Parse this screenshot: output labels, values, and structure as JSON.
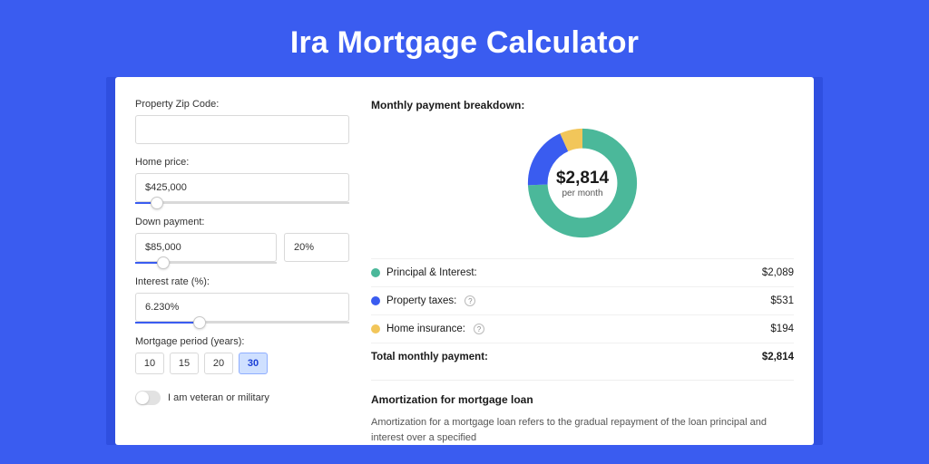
{
  "page": {
    "title": "Ira Mortgage Calculator"
  },
  "form": {
    "zip_label": "Property Zip Code:",
    "zip_value": "",
    "home_price_label": "Home price:",
    "home_price_value": "$425,000",
    "home_price_slider_pct": 10,
    "down_label": "Down payment:",
    "down_amount_value": "$85,000",
    "down_pct_value": "20%",
    "down_slider_pct": 20,
    "rate_label": "Interest rate (%):",
    "rate_value": "6.230%",
    "rate_slider_pct": 30,
    "period_label": "Mortgage period (years):",
    "period_options": [
      "10",
      "15",
      "20",
      "30"
    ],
    "period_selected": "30",
    "veteran_label": "I am veteran or military",
    "veteran_on": false
  },
  "breakdown": {
    "title": "Monthly payment breakdown:",
    "center_amount": "$2,814",
    "center_sub": "per month",
    "items": [
      {
        "label": "Principal & Interest:",
        "value": "$2,089",
        "color": "green",
        "help": false
      },
      {
        "label": "Property taxes:",
        "value": "$531",
        "color": "blue",
        "help": true
      },
      {
        "label": "Home insurance:",
        "value": "$194",
        "color": "yellow",
        "help": true
      }
    ],
    "total_label": "Total monthly payment:",
    "total_value": "$2,814"
  },
  "amort": {
    "title": "Amortization for mortgage loan",
    "text": "Amortization for a mortgage loan refers to the gradual repayment of the loan principal and interest over a specified"
  },
  "chart_data": {
    "type": "pie",
    "title": "Monthly payment breakdown",
    "series": [
      {
        "name": "Principal & Interest",
        "value": 2089,
        "color": "#4bb89a"
      },
      {
        "name": "Property taxes",
        "value": 531,
        "color": "#3a5cf0"
      },
      {
        "name": "Home insurance",
        "value": 194,
        "color": "#f2c65a"
      }
    ],
    "total": 2814,
    "center_label": "$2,814 per month"
  }
}
